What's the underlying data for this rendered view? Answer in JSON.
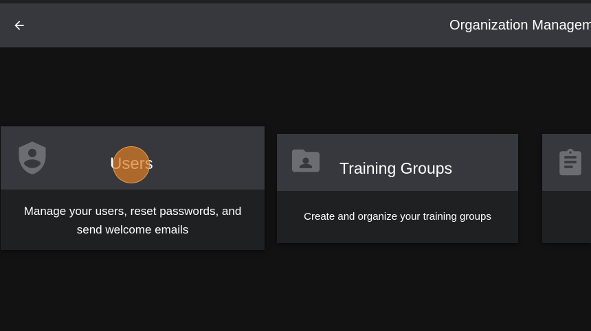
{
  "header": {
    "title": "Organization Management"
  },
  "cards": [
    {
      "title": "Users",
      "description": "Manage your users, reset passwords, and send welcome emails",
      "icon": "shield-person-icon"
    },
    {
      "title": "Training Groups",
      "description": "Create and organize your training groups",
      "icon": "folder-person-icon"
    },
    {
      "title": "",
      "description": "",
      "icon": "clipboard-icon"
    }
  ],
  "colors": {
    "background": "#121213",
    "appbar": "#36383d",
    "card_header": "#36383d",
    "card_body": "#1f2022",
    "icon": "#6b6d72",
    "click_indicator": "#db7c26"
  }
}
